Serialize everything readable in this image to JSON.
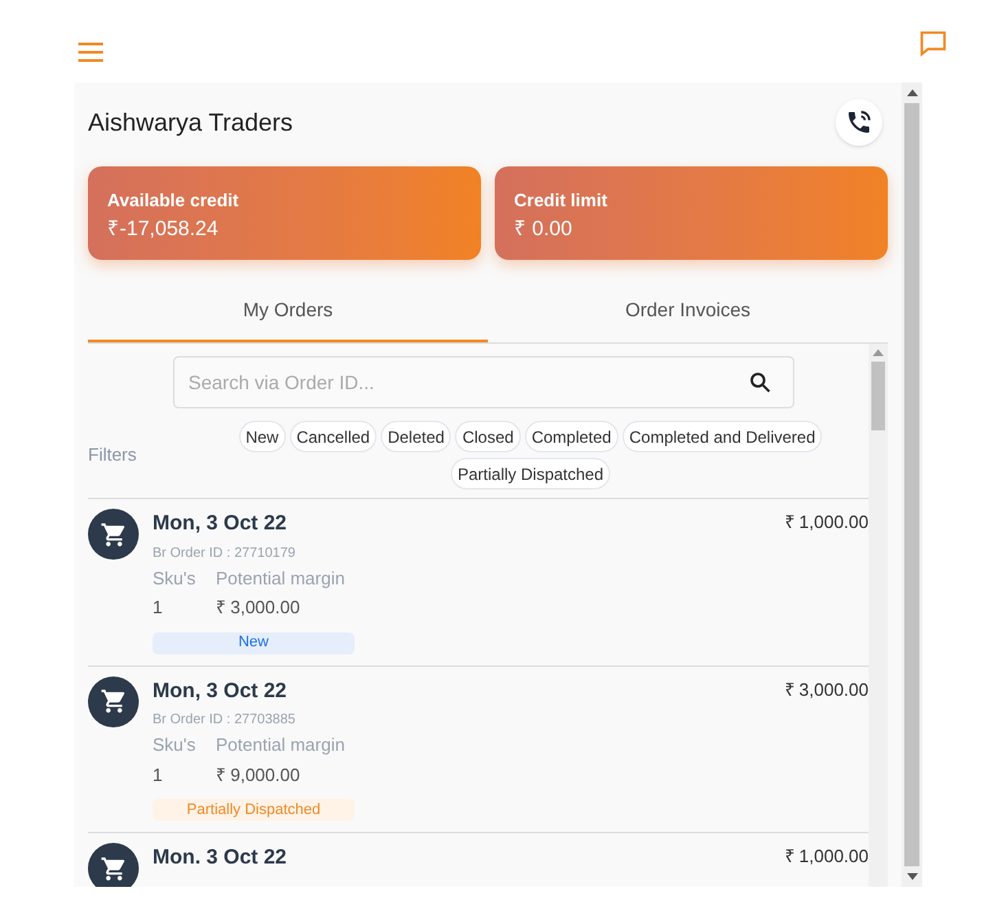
{
  "company": {
    "name": "Aishwarya Traders"
  },
  "credit_cards": [
    {
      "label": "Available credit",
      "value": "₹-17,058.24"
    },
    {
      "label": "Credit limit",
      "value": "₹ 0.00"
    }
  ],
  "tabs": [
    {
      "label": "My Orders",
      "selected": true
    },
    {
      "label": "Order Invoices",
      "selected": false
    }
  ],
  "search": {
    "placeholder": "Search via Order ID..."
  },
  "filters": {
    "label": "Filters",
    "chips": [
      "New",
      "Cancelled",
      "Deleted",
      "Closed",
      "Completed",
      "Completed and Delivered",
      "Partially Dispatched"
    ]
  },
  "orders": [
    {
      "date": "Mon, 3 Oct 22",
      "order_id": "Br Order ID : 27710179",
      "sku_label": "Sku's",
      "margin_label": "Potential margin",
      "skus": "1",
      "margin": "₹ 3,000.00",
      "amount": "₹ 1,000.00",
      "status": {
        "label": "New",
        "kind": "new"
      }
    },
    {
      "date": "Mon, 3 Oct 22",
      "order_id": "Br Order ID : 27703885",
      "sku_label": "Sku's",
      "margin_label": "Potential margin",
      "skus": "1",
      "margin": "₹ 9,000.00",
      "amount": "₹ 3,000.00",
      "status": {
        "label": "Partially Dispatched",
        "kind": "partial"
      }
    },
    {
      "date": "Mon. 3 Oct 22",
      "amount": "₹ 1,000.00"
    }
  ]
}
